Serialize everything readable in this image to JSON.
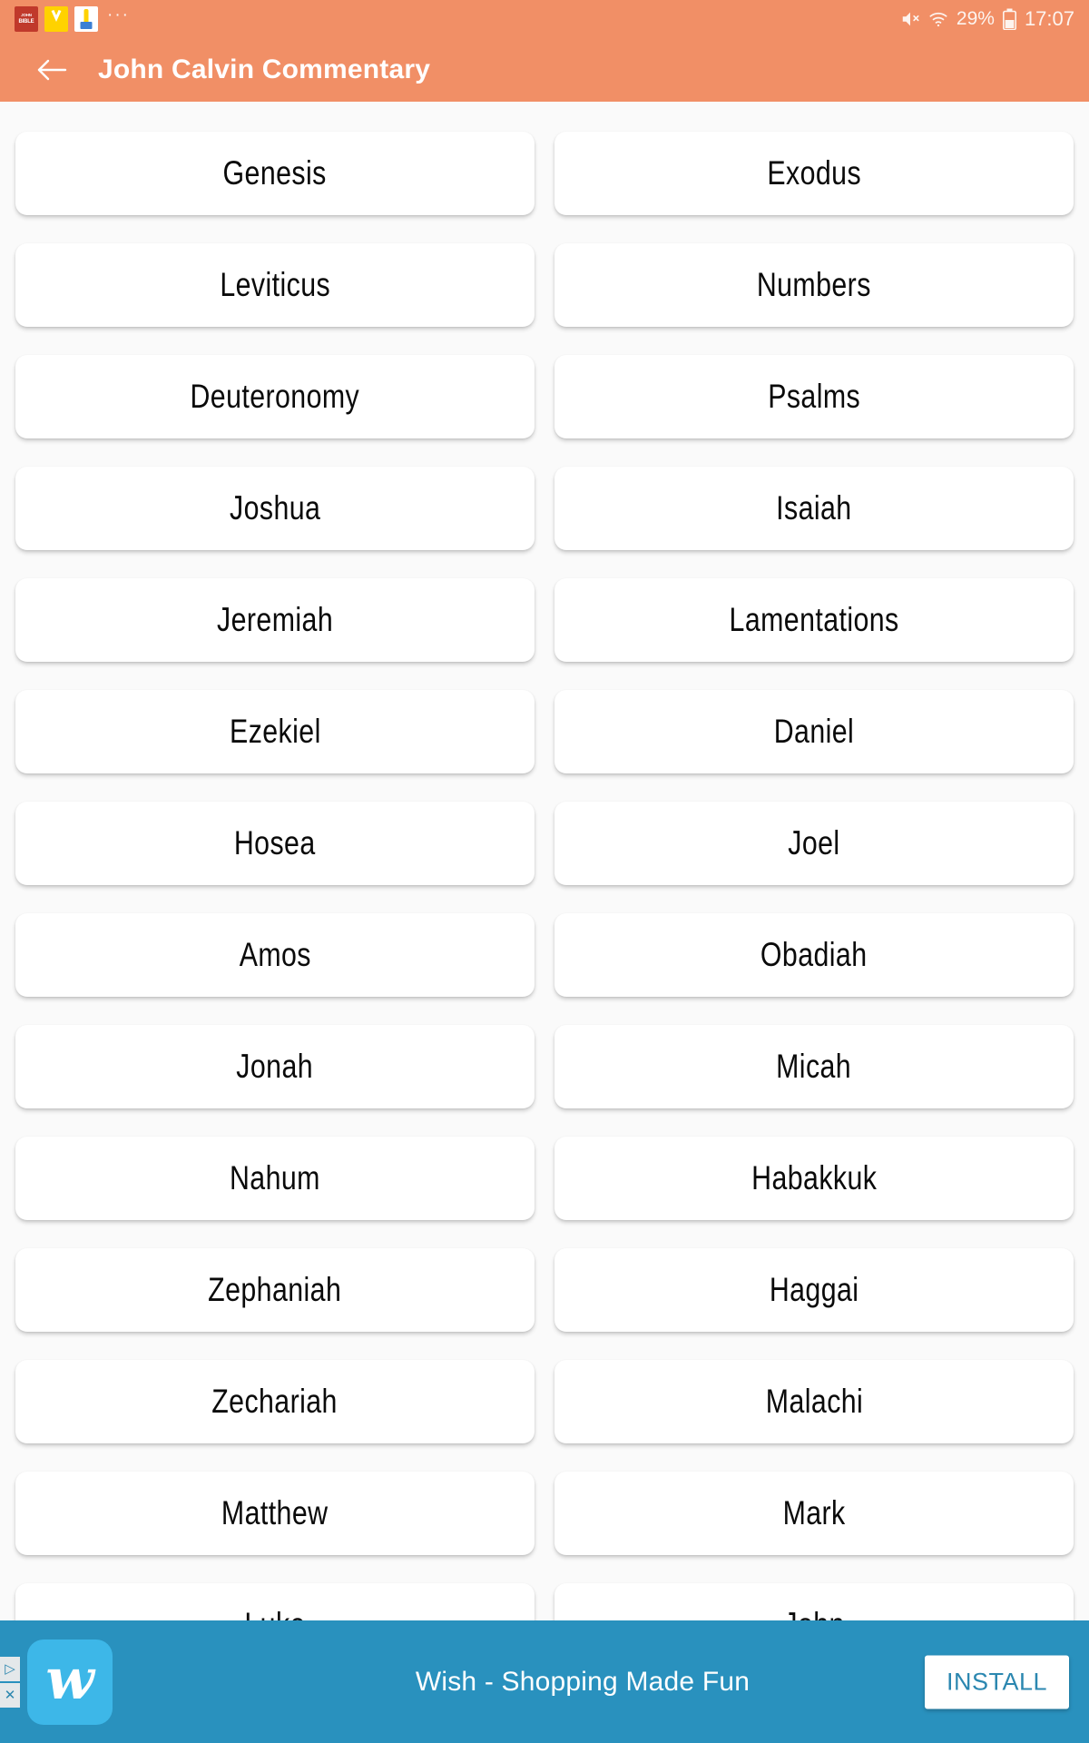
{
  "statusbar": {
    "notifications": [
      {
        "name": "bible-app-icon",
        "line1": "JOHN",
        "line2": "BIBLE"
      },
      {
        "name": "yellow-app-icon",
        "label": ""
      },
      {
        "name": "white-blue-app-icon",
        "label": ""
      }
    ],
    "ellipsis": "···",
    "battery_percent": "29%",
    "time": "17:07",
    "icons": [
      "mute-icon",
      "wifi-icon",
      "battery-icon"
    ]
  },
  "appbar": {
    "back_icon": "back-arrow-icon",
    "title": "John Calvin Commentary",
    "background_color": "#F18F66",
    "title_color": "#FFFFFF"
  },
  "books": {
    "rows": [
      [
        {
          "label": "Genesis"
        },
        {
          "label": "Exodus"
        }
      ],
      [
        {
          "label": "Leviticus"
        },
        {
          "label": "Numbers"
        }
      ],
      [
        {
          "label": "Deuteronomy"
        },
        {
          "label": "Psalms"
        }
      ],
      [
        {
          "label": "Joshua"
        },
        {
          "label": "Isaiah"
        }
      ],
      [
        {
          "label": "Jeremiah"
        },
        {
          "label": "Lamentations"
        }
      ],
      [
        {
          "label": "Ezekiel"
        },
        {
          "label": "Daniel"
        }
      ],
      [
        {
          "label": "Hosea"
        },
        {
          "label": "Joel"
        }
      ],
      [
        {
          "label": "Amos"
        },
        {
          "label": "Obadiah"
        }
      ],
      [
        {
          "label": "Jonah"
        },
        {
          "label": "Micah"
        }
      ],
      [
        {
          "label": "Nahum"
        },
        {
          "label": "Habakkuk"
        }
      ],
      [
        {
          "label": "Zephaniah"
        },
        {
          "label": "Haggai"
        }
      ],
      [
        {
          "label": "Zechariah"
        },
        {
          "label": "Malachi"
        }
      ],
      [
        {
          "label": "Matthew"
        },
        {
          "label": "Mark"
        }
      ],
      [
        {
          "label": "Luke"
        },
        {
          "label": "John"
        }
      ]
    ],
    "card_background": "#FFFFFF",
    "page_background": "#FAFAFA",
    "text_color": "#0A0A0A"
  },
  "ad": {
    "logo_letter": "w",
    "headline": "Wish - Shopping Made Fun",
    "install_label": "INSTALL",
    "adchoices_play": "▷",
    "adchoices_close": "✕",
    "background_color": "#2991BE",
    "logo_color": "#3DB7E8",
    "install_text_color": "#2B87B0"
  }
}
